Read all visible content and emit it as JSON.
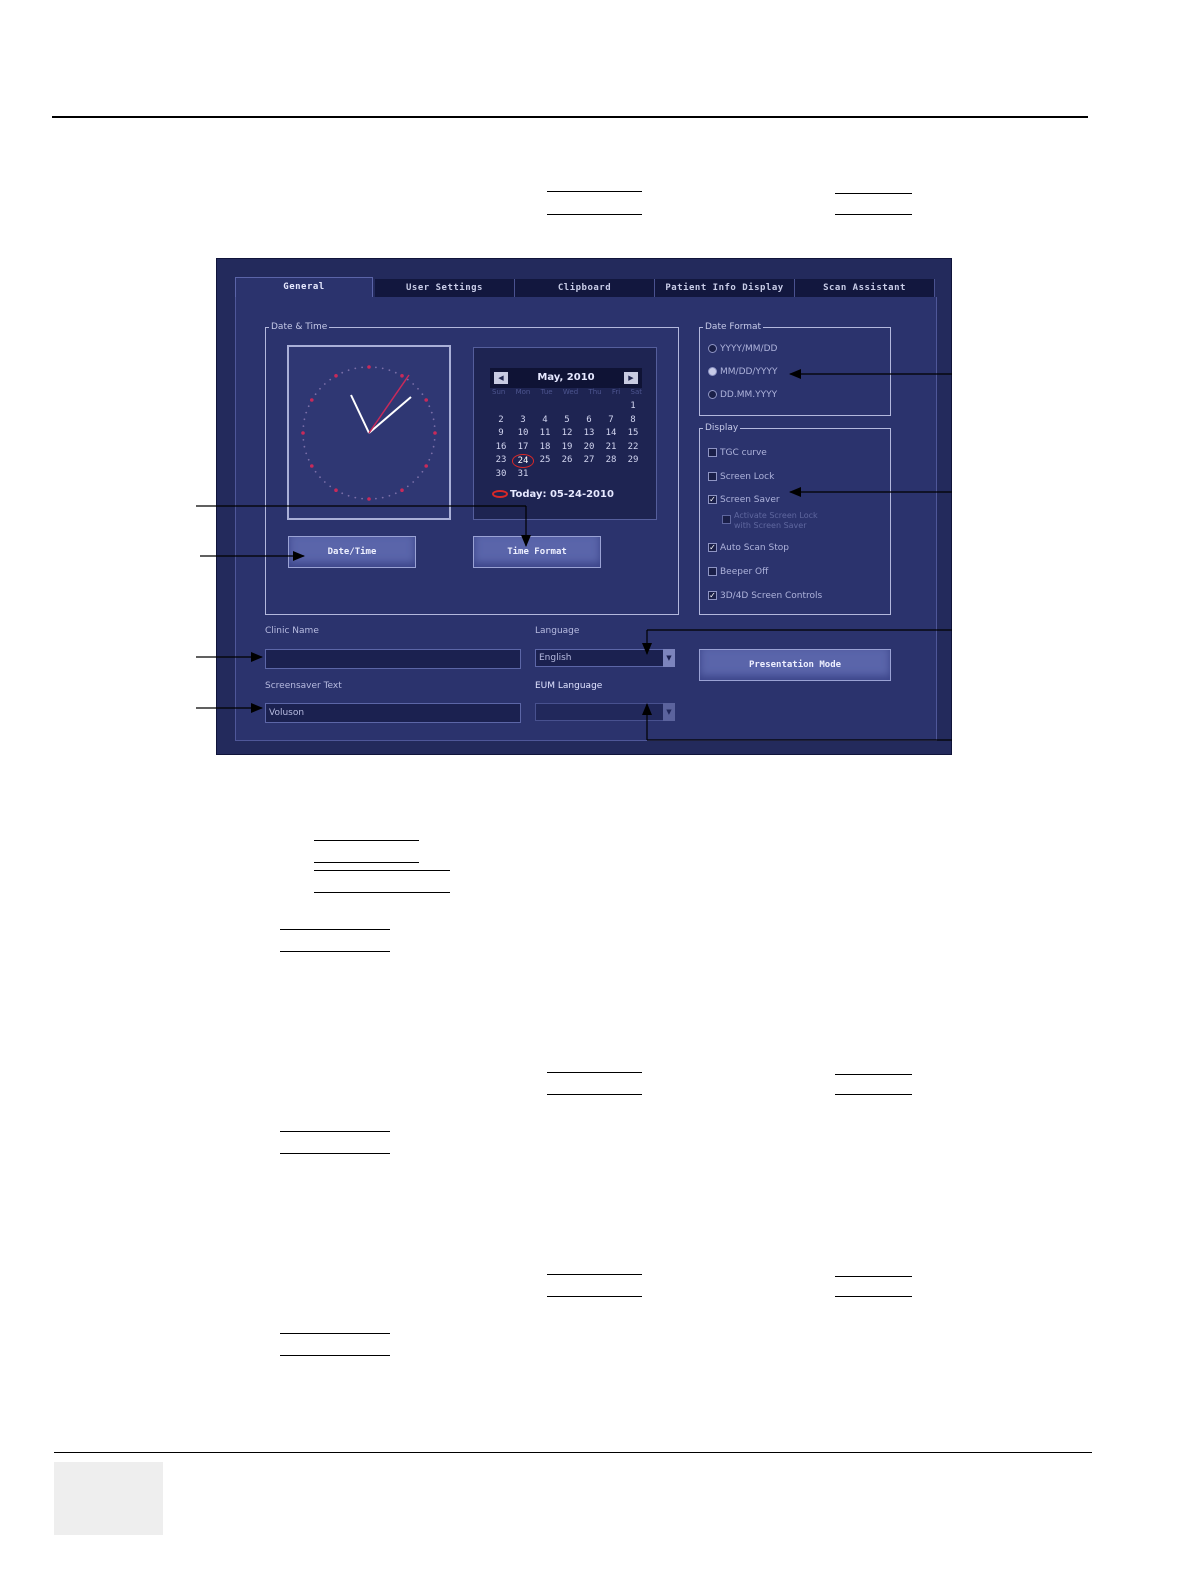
{
  "tabs": [
    "General",
    "User Settings",
    "Clipboard",
    "Patient Info Display",
    "Scan Assistant"
  ],
  "active_tab": "General",
  "date_time": {
    "legend": "Date & Time",
    "calendar": {
      "prev": "◀",
      "next": "▶",
      "month_title": "May, 2010",
      "weekdays": [
        "Sun",
        "Mon",
        "Tue",
        "Wed",
        "Thu",
        "Fri",
        "Sat"
      ],
      "weeks": [
        [
          "",
          "",
          "",
          "",
          "",
          "",
          "1"
        ],
        [
          "2",
          "3",
          "4",
          "5",
          "6",
          "7",
          "8"
        ],
        [
          "9",
          "10",
          "11",
          "12",
          "13",
          "14",
          "15"
        ],
        [
          "16",
          "17",
          "18",
          "19",
          "20",
          "21",
          "22"
        ],
        [
          "23",
          "24",
          "25",
          "26",
          "27",
          "28",
          "29"
        ],
        [
          "30",
          "31",
          "",
          "",
          "",
          "",
          ""
        ]
      ],
      "today_day": "24",
      "today_label": "Today: 05-24-2010"
    },
    "date_time_button": "Date/Time",
    "time_format_button": "Time Format"
  },
  "date_format": {
    "legend": "Date Format",
    "options": [
      "YYYY/MM/DD",
      "MM/DD/YYYY",
      "DD.MM.YYYY"
    ],
    "selected": "MM/DD/YYYY"
  },
  "display": {
    "legend": "Display",
    "options": [
      {
        "label": "TGC curve",
        "checked": false
      },
      {
        "label": "Screen Lock",
        "checked": false
      },
      {
        "label": "Screen Saver",
        "checked": true
      },
      {
        "label": "Activate Screen Lock with Screen Saver",
        "checked": false
      },
      {
        "label": "Auto Scan Stop",
        "checked": true
      },
      {
        "label": "Beeper Off",
        "checked": false
      },
      {
        "label": "3D/4D Screen Controls",
        "checked": true
      }
    ]
  },
  "clinic_name": {
    "label": "Clinic Name",
    "value": ""
  },
  "screensaver_text": {
    "label": "Screensaver Text",
    "value": "Voluson"
  },
  "language": {
    "label": "Language",
    "value": "English"
  },
  "eum_language": {
    "label": "EUM Language",
    "value": ""
  },
  "presentation_mode_button": "Presentation Mode",
  "colors": {
    "panel": "#2b336d",
    "accent_red": "#d82828"
  }
}
